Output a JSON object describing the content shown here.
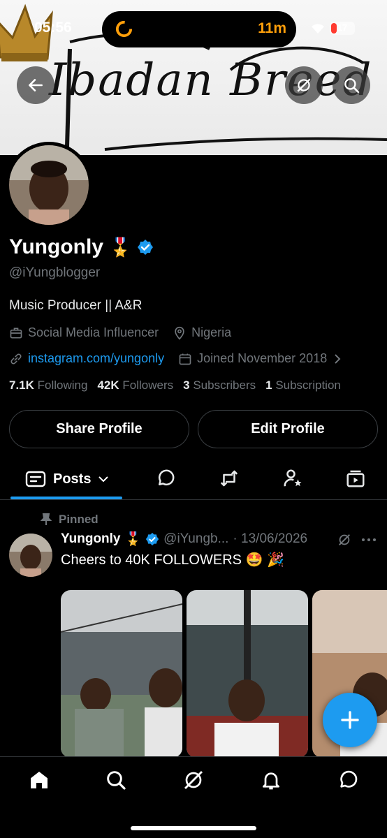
{
  "status_bar": {
    "time": "05:56",
    "activity": "11m",
    "battery": "17"
  },
  "banner": {
    "text": "Ibadan Breed"
  },
  "profile": {
    "name": "Yungonly",
    "medal_emoji": "🎖️",
    "handle": "@iYungblogger",
    "bio": "Music Producer || A&R",
    "category": "Social Media Influencer",
    "location": "Nigeria",
    "website": "instagram.com/yungonly",
    "joined": "Joined November 2018"
  },
  "stats": {
    "following_count": "7.1K",
    "following_label": "Following",
    "followers_count": "42K",
    "followers_label": "Followers",
    "subscribers_count": "3",
    "subscribers_label": "Subscribers",
    "subscription_count": "1",
    "subscription_label": "Subscription"
  },
  "buttons": {
    "share": "Share Profile",
    "edit": "Edit Profile"
  },
  "tabs": {
    "posts": "Posts"
  },
  "post": {
    "pinned_label": "Pinned",
    "author": "Yungonly",
    "medal_emoji": "🎖️",
    "handle": "@iYungb...",
    "date": "· 13/06/2026",
    "text": "Cheers to 40K FOLLOWERS 🤩 🎉"
  },
  "colors": {
    "accent": "#1d9bf0",
    "background": "#000000",
    "muted": "#71767b"
  },
  "icons": [
    "back-arrow-icon",
    "grok-icon",
    "search-icon",
    "briefcase-icon",
    "location-pin-icon",
    "link-icon",
    "calendar-icon",
    "chevron-right-icon",
    "verified-badge-icon",
    "posts-tab-icon",
    "chevron-down-icon",
    "reply-tab-icon",
    "repost-tab-icon",
    "affiliates-tab-icon",
    "media-tab-icon",
    "pin-icon",
    "more-icon",
    "compose-plus-icon",
    "home-icon",
    "explore-icon",
    "grok-nav-icon",
    "notifications-icon",
    "messages-icon"
  ]
}
